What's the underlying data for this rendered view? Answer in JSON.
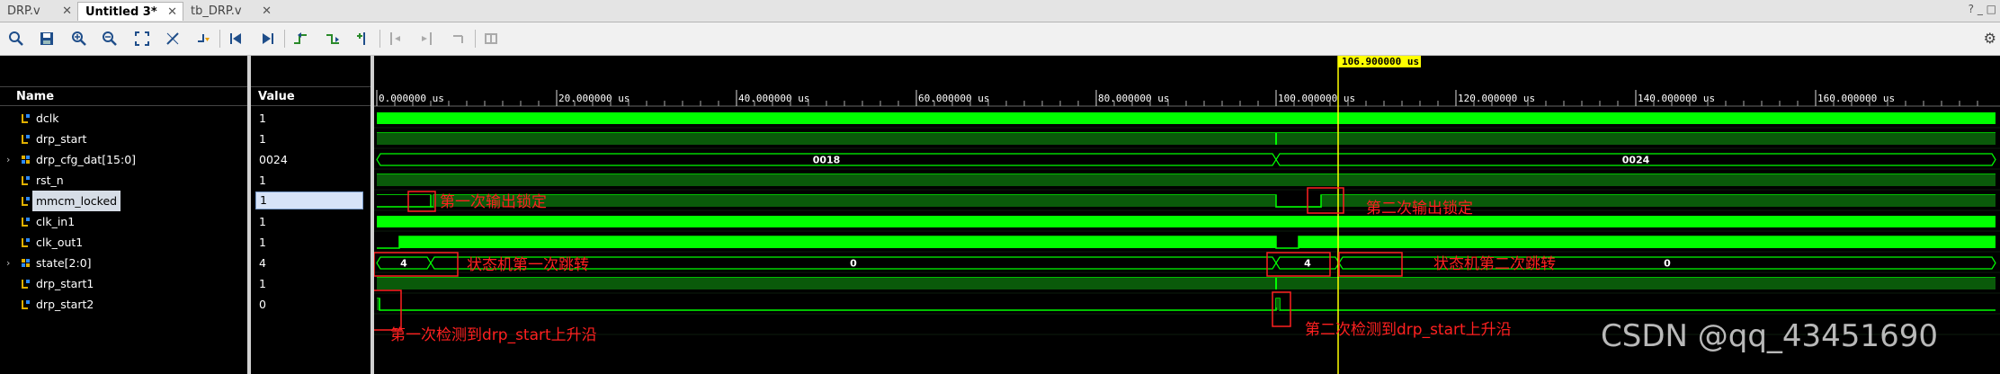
{
  "tabs": [
    {
      "label": "DRP.v",
      "active": false
    },
    {
      "label": "Untitled 3*",
      "active": true
    },
    {
      "label": "tb_DRP.v",
      "active": false
    }
  ],
  "tab_controls": "? _ □",
  "toolbar_icons": [
    "search-icon",
    "save-icon",
    "zoom-in-icon",
    "zoom-out-icon",
    "zoom-fit-icon",
    "cursor-icon",
    "go-to-cursor-icon",
    "go-to-start-icon",
    "go-to-end-icon",
    "previous-transition-icon",
    "next-transition-icon",
    "add-marker-icon",
    "previous-marker-icon",
    "next-marker-icon",
    "swap-cursors-icon",
    "snap-icon",
    "gear-icon"
  ],
  "headers": {
    "name": "Name",
    "value": "Value"
  },
  "signals": [
    {
      "name": "dclk",
      "value": "1",
      "kind": "bit",
      "expandable": false
    },
    {
      "name": "drp_start",
      "value": "1",
      "kind": "bit",
      "expandable": false
    },
    {
      "name": "drp_cfg_dat[15:0]",
      "value": "0024",
      "kind": "bus",
      "expandable": true
    },
    {
      "name": "rst_n",
      "value": "1",
      "kind": "bit",
      "expandable": false
    },
    {
      "name": "mmcm_locked",
      "value": "1",
      "kind": "bit",
      "expandable": false,
      "selected": true
    },
    {
      "name": "clk_in1",
      "value": "1",
      "kind": "bit",
      "expandable": false
    },
    {
      "name": "clk_out1",
      "value": "1",
      "kind": "bit",
      "expandable": false
    },
    {
      "name": "state[2:0]",
      "value": "4",
      "kind": "bus",
      "expandable": true
    },
    {
      "name": "drp_start1",
      "value": "1",
      "kind": "bit",
      "expandable": false
    },
    {
      "name": "drp_start2",
      "value": "0",
      "kind": "bit",
      "expandable": false
    }
  ],
  "timeline": {
    "ticks": [
      "0.000000 us",
      "20.000000 us",
      "40.000000 us",
      "60.000000 us",
      "80.000000 us",
      "100.000000 us",
      "120.000000 us",
      "140.000000 us",
      "160.000000 us"
    ],
    "cursor_label": "106.900000 us",
    "cursor_time_us": 106.9,
    "range_us": [
      0,
      180
    ]
  },
  "bus_values": {
    "drp_cfg_dat": [
      "0018",
      "0024"
    ],
    "state": [
      "4",
      "0",
      "4",
      "0"
    ]
  },
  "annotations": [
    {
      "id": "ann1",
      "text": "第一次输出锁定"
    },
    {
      "id": "ann2",
      "text": "第二次输出锁定"
    },
    {
      "id": "ann3",
      "text": "状态机第一次跳转"
    },
    {
      "id": "ann4",
      "text": "状态机第二次跳转"
    },
    {
      "id": "ann5",
      "text": "第一次检测到drp_start上升沿"
    },
    {
      "id": "ann6",
      "text": "第二次检测到drp_start上升沿"
    }
  ],
  "colors": {
    "wave": "#00ff00",
    "wave_dark": "#0a5a0a",
    "cursor": "#ffff00",
    "annotation": "#ff2020",
    "cursor_label_bg": "#ffff00"
  },
  "watermark": "CSDN @qq_43451690"
}
